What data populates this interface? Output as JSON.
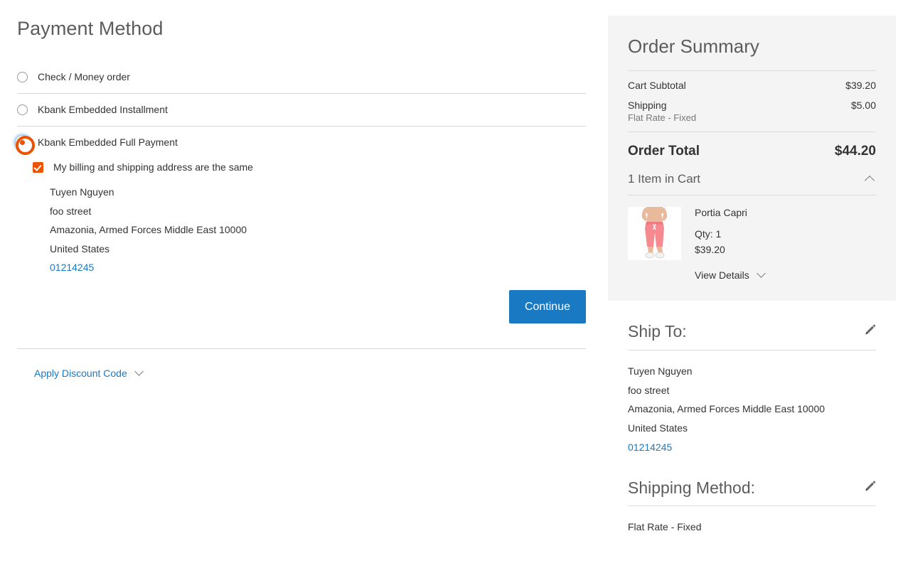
{
  "payment": {
    "page_title": "Payment Method",
    "methods": [
      {
        "label": "Check / Money order",
        "selected": false
      },
      {
        "label": "Kbank Embedded Installment",
        "selected": false
      },
      {
        "label": "Kbank Embedded Full Payment",
        "selected": true
      }
    ],
    "billing_same_label": "My billing and shipping address are the same",
    "billing_same_checked": true,
    "billing_address": [
      "Tuyen Nguyen",
      "foo street",
      "Amazonia, Armed Forces Middle East 10000",
      "United States"
    ],
    "billing_phone": "01214245",
    "continue_label": "Continue",
    "discount_label": "Apply Discount Code"
  },
  "summary": {
    "title": "Order Summary",
    "subtotal_label": "Cart Subtotal",
    "subtotal_value": "$39.20",
    "shipping_label": "Shipping",
    "shipping_value": "$5.00",
    "shipping_note": "Flat Rate - Fixed",
    "total_label": "Order Total",
    "total_value": "$44.20",
    "items_header": "1 Item in Cart",
    "item": {
      "name": "Portia Capri",
      "qty": "Qty: 1",
      "price": "$39.20",
      "view_details": "View Details"
    }
  },
  "ship_to": {
    "title": "Ship To:",
    "lines": [
      "Tuyen Nguyen",
      "foo street",
      "Amazonia, Armed Forces Middle East 10000",
      "United States"
    ],
    "phone": "01214245"
  },
  "shipping_method": {
    "title": "Shipping Method:",
    "value": "Flat Rate - Fixed"
  },
  "colors": {
    "accent_orange": "#eb5202",
    "link_blue": "#1979c3",
    "button_blue": "#1979c3",
    "panel_gray": "#f4f4f4"
  }
}
